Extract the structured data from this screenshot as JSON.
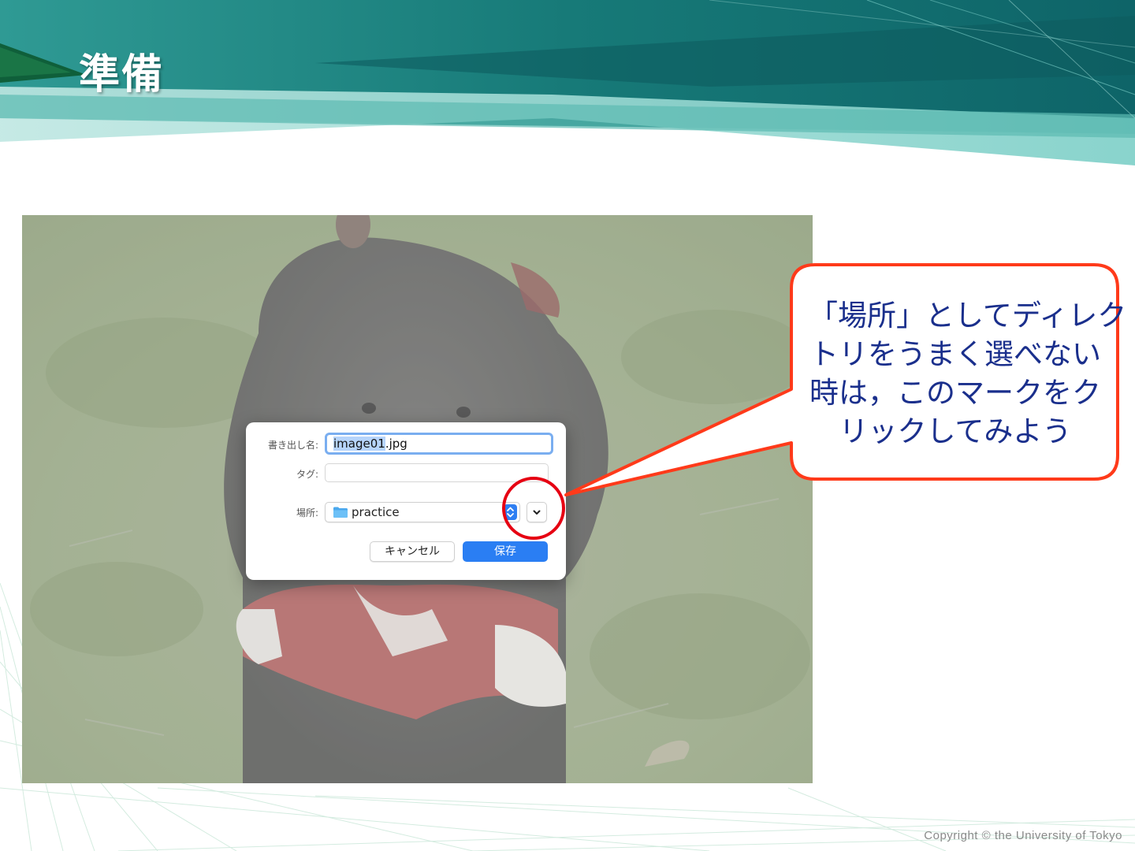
{
  "slide": {
    "title": "準備",
    "copyright": "Copyright © the University of Tokyo"
  },
  "colors": {
    "header_dark": "#0e6468",
    "header_mid": "#2e9c96",
    "header_light": "#9ad8d2",
    "callout_border": "#ff3a1a",
    "callout_text": "#1a2f8c",
    "highlight_circle": "#e60012",
    "accent_blue": "#2a7ef3"
  },
  "save_dialog": {
    "filename_label": "書き出し名:",
    "filename_selected": "image01",
    "filename_extension": ".jpg",
    "tags_label": "タグ:",
    "tags_value": "",
    "location_label": "場所:",
    "location_value": "practice",
    "location_icon": "folder-icon",
    "expand_icon": "chevron-down-icon",
    "cancel_label": "キャンセル",
    "save_label": "保存"
  },
  "callout": {
    "lines": [
      "「場所」としてディレク",
      "トリをうまく選べない",
      "時は，このマークをク",
      "リックしてみよう"
    ]
  }
}
